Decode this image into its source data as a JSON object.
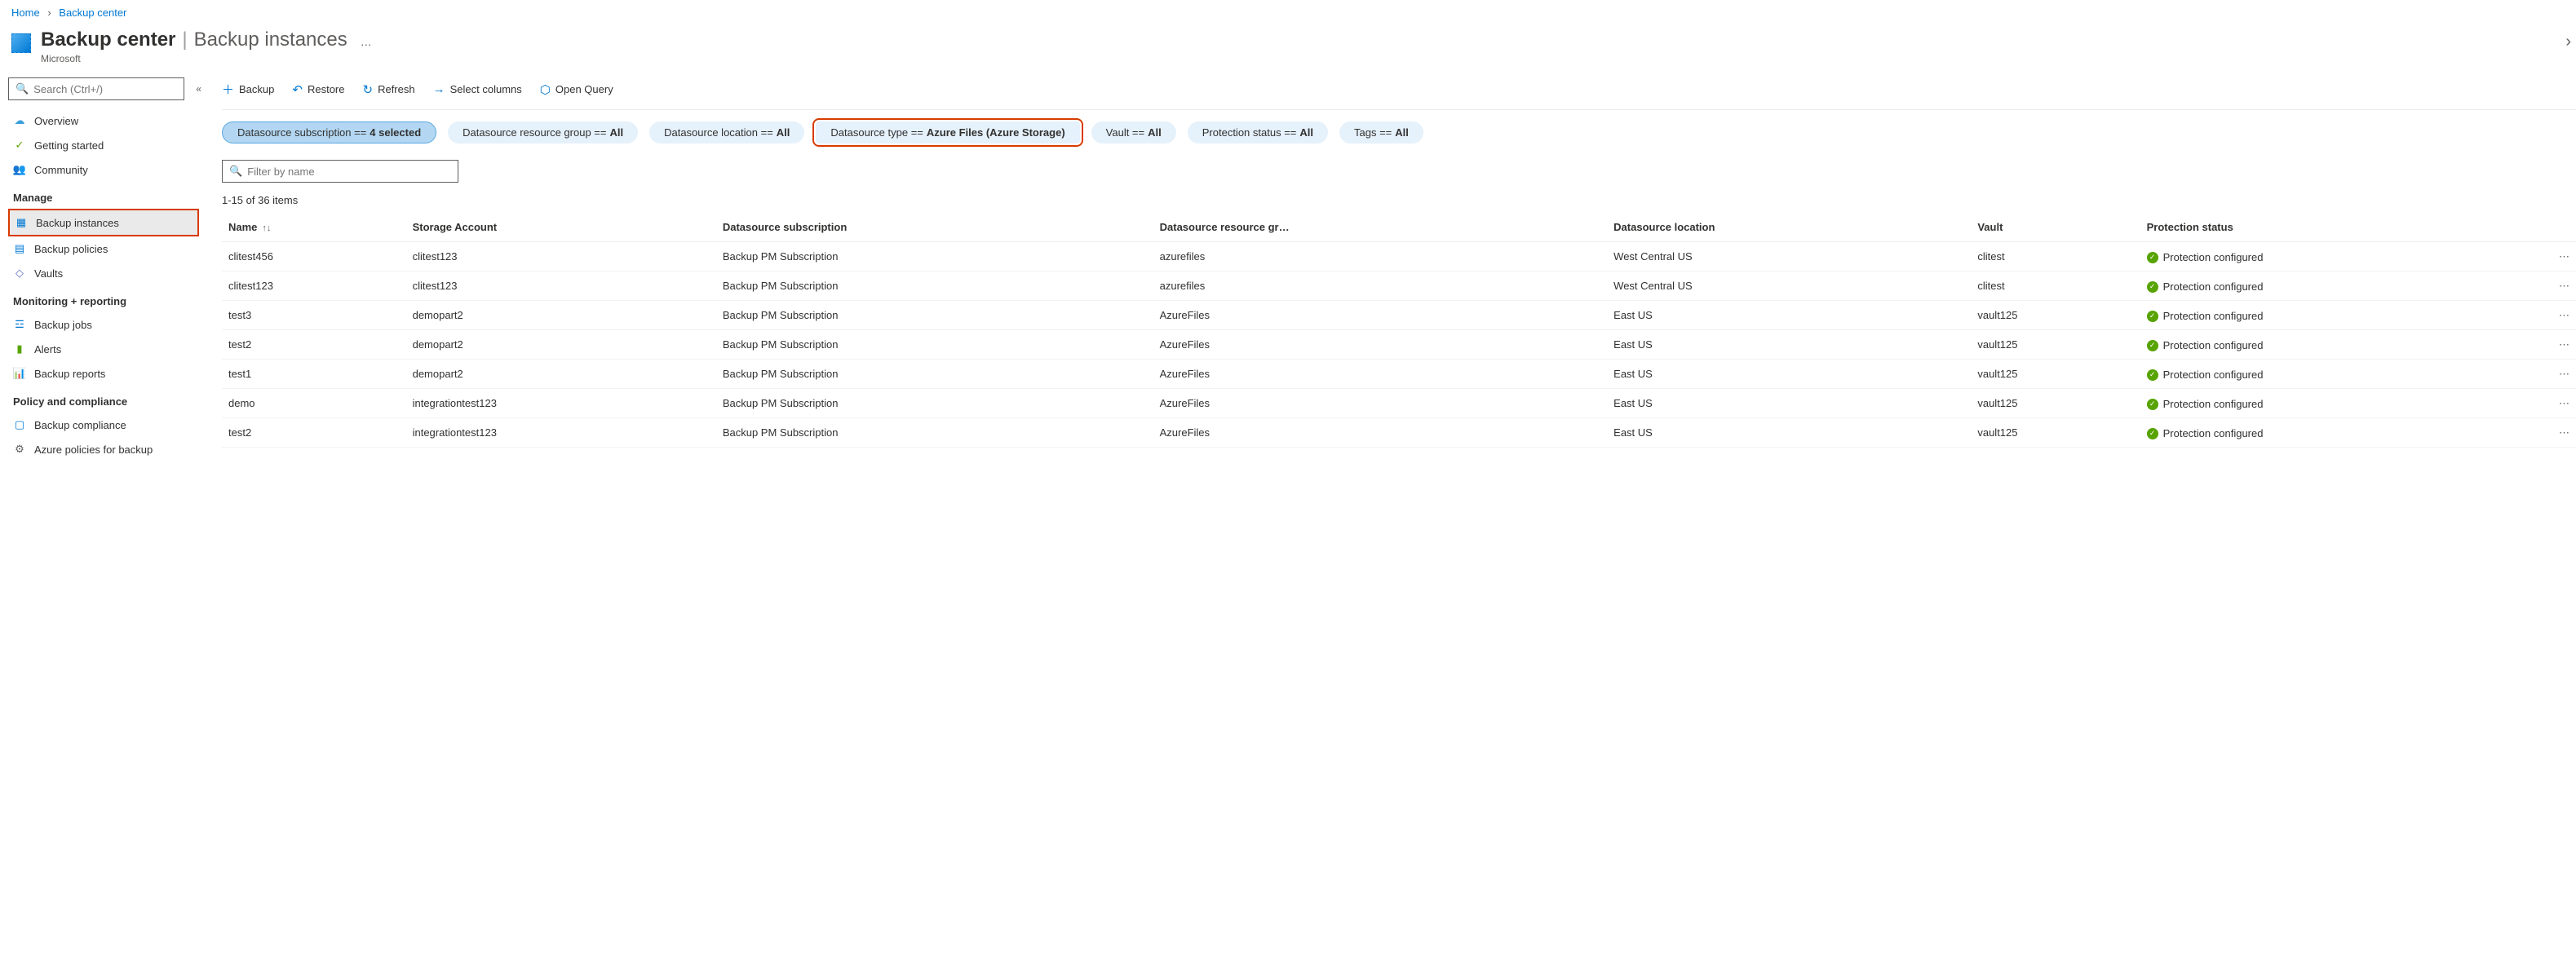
{
  "breadcrumb": {
    "home": "Home",
    "current": "Backup center"
  },
  "header": {
    "title": "Backup center",
    "subtitle": "Backup instances",
    "company": "Microsoft"
  },
  "sidebar": {
    "search_placeholder": "Search (Ctrl+/)",
    "items_top": [
      {
        "label": "Overview",
        "icon": "cloud"
      },
      {
        "label": "Getting started",
        "icon": "rocket"
      },
      {
        "label": "Community",
        "icon": "people"
      }
    ],
    "sections": [
      {
        "title": "Manage",
        "items": [
          {
            "label": "Backup instances",
            "icon": "grid",
            "active": true,
            "highlight": true
          },
          {
            "label": "Backup policies",
            "icon": "cal"
          },
          {
            "label": "Vaults",
            "icon": "lock"
          }
        ]
      },
      {
        "title": "Monitoring + reporting",
        "items": [
          {
            "label": "Backup jobs",
            "icon": "list"
          },
          {
            "label": "Alerts",
            "icon": "alert"
          },
          {
            "label": "Backup reports",
            "icon": "chart"
          }
        ]
      },
      {
        "title": "Policy and compliance",
        "items": [
          {
            "label": "Backup compliance",
            "icon": "doc"
          },
          {
            "label": "Azure policies for backup",
            "icon": "gear"
          }
        ]
      }
    ]
  },
  "toolbar": [
    {
      "label": "Backup",
      "icon": "plus"
    },
    {
      "label": "Restore",
      "icon": "undo"
    },
    {
      "label": "Refresh",
      "icon": "refresh"
    },
    {
      "label": "Select columns",
      "icon": "arrow"
    },
    {
      "label": "Open Query",
      "icon": "query"
    }
  ],
  "filters": [
    {
      "prefix": "Datasource subscription == ",
      "value": "4 selected",
      "selected": true
    },
    {
      "prefix": "Datasource resource group == ",
      "value": "All"
    },
    {
      "prefix": "Datasource location == ",
      "value": "All"
    },
    {
      "prefix": "Datasource type == ",
      "value": "Azure Files (Azure Storage)",
      "highlight": true
    },
    {
      "prefix": "Vault == ",
      "value": "All"
    },
    {
      "prefix": "Protection status == ",
      "value": "All"
    },
    {
      "prefix": "Tags == ",
      "value": "All"
    }
  ],
  "filter_placeholder": "Filter by name",
  "count_text": "1-15 of 36 items",
  "columns": [
    "Name",
    "Storage Account",
    "Datasource subscription",
    "Datasource resource gr…",
    "Datasource location",
    "Vault",
    "Protection status"
  ],
  "rows": [
    {
      "name": "clitest456",
      "storage": "clitest123",
      "sub": "Backup PM Subscription",
      "rg": "azurefiles",
      "loc": "West Central US",
      "vault": "clitest",
      "status": "Protection configured"
    },
    {
      "name": "clitest123",
      "storage": "clitest123",
      "sub": "Backup PM Subscription",
      "rg": "azurefiles",
      "loc": "West Central US",
      "vault": "clitest",
      "status": "Protection configured"
    },
    {
      "name": "test3",
      "storage": "demopart2",
      "sub": "Backup PM Subscription",
      "rg": "AzureFiles",
      "loc": "East US",
      "vault": "vault125",
      "status": "Protection configured"
    },
    {
      "name": "test2",
      "storage": "demopart2",
      "sub": "Backup PM Subscription",
      "rg": "AzureFiles",
      "loc": "East US",
      "vault": "vault125",
      "status": "Protection configured"
    },
    {
      "name": "test1",
      "storage": "demopart2",
      "sub": "Backup PM Subscription",
      "rg": "AzureFiles",
      "loc": "East US",
      "vault": "vault125",
      "status": "Protection configured"
    },
    {
      "name": "demo",
      "storage": "integrationtest123",
      "sub": "Backup PM Subscription",
      "rg": "AzureFiles",
      "loc": "East US",
      "vault": "vault125",
      "status": "Protection configured"
    },
    {
      "name": "test2",
      "storage": "integrationtest123",
      "sub": "Backup PM Subscription",
      "rg": "AzureFiles",
      "loc": "East US",
      "vault": "vault125",
      "status": "Protection configured"
    }
  ]
}
